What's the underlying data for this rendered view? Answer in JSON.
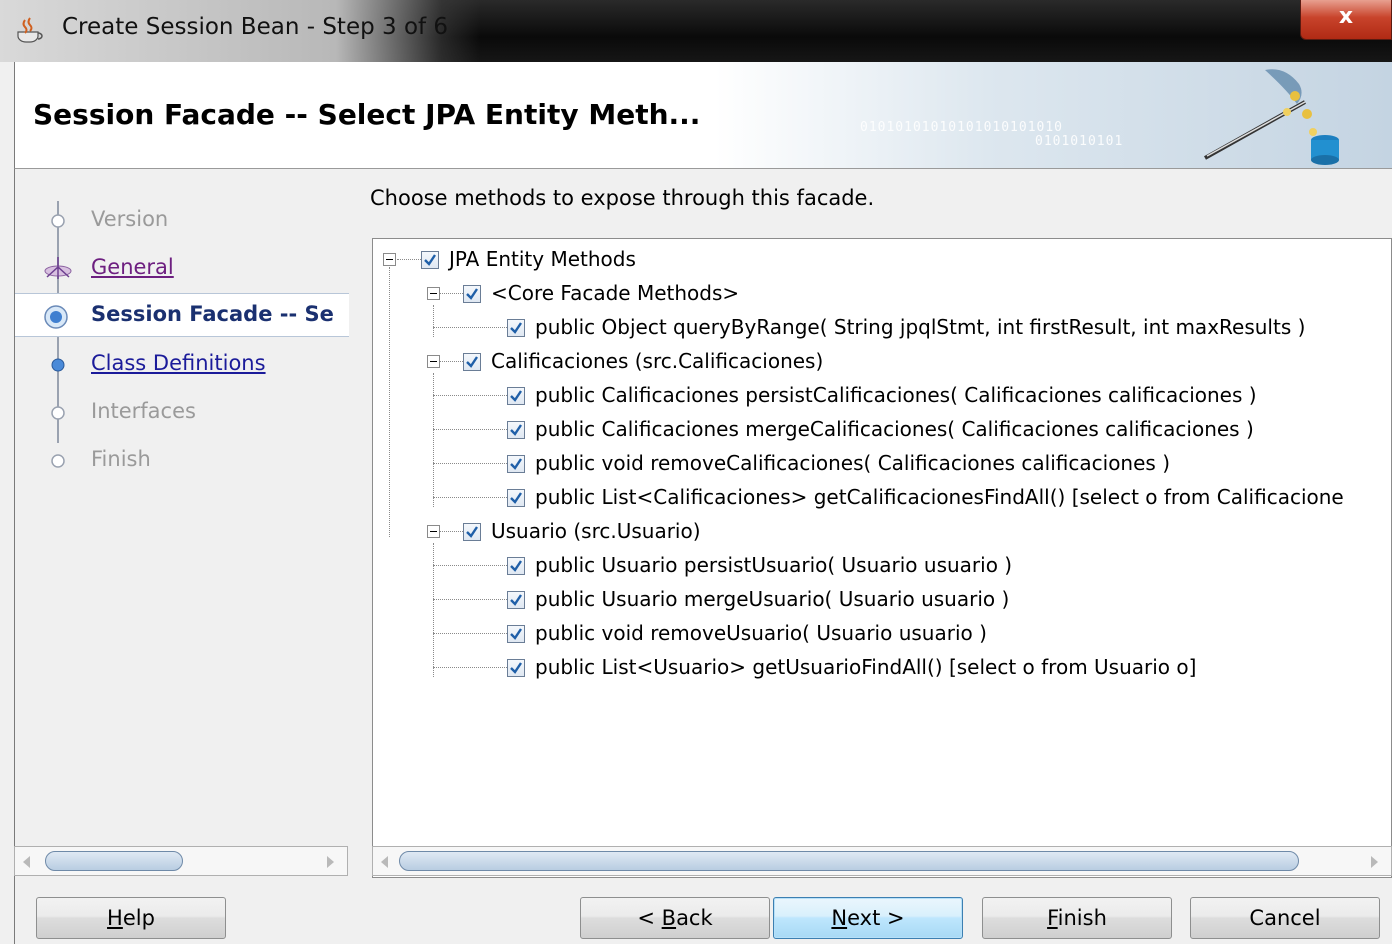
{
  "window": {
    "title": "Create Session Bean - Step 3 of 6",
    "close_label": "x"
  },
  "header": {
    "heading": "Session Facade -- Select JPA Entity Meth...",
    "binary_deco_1": "01010101010101010101010",
    "binary_deco_2": "0101010101"
  },
  "steps": [
    {
      "label": "Version",
      "state": "disabled"
    },
    {
      "label": "General",
      "state": "visited"
    },
    {
      "label": "Session Facade -- Se",
      "state": "current"
    },
    {
      "label": "Class Definitions",
      "state": "link"
    },
    {
      "label": "Interfaces",
      "state": "disabled"
    },
    {
      "label": "Finish",
      "state": "disabled"
    }
  ],
  "content": {
    "instruction": "Choose methods to expose through this facade."
  },
  "tree": {
    "root": "JPA Entity Methods",
    "groups": [
      {
        "label": "<Core Facade Methods>",
        "items": [
          "public Object queryByRange( String jpqlStmt, int firstResult, int maxResults )"
        ]
      },
      {
        "label": "Calificaciones (src.Calificaciones)",
        "items": [
          "public Calificaciones persistCalificaciones( Calificaciones calificaciones )",
          "public Calificaciones mergeCalificaciones( Calificaciones calificaciones )",
          "public void removeCalificaciones( Calificaciones calificaciones )",
          "public List<Calificaciones> getCalificacionesFindAll() [select o from Calificacione"
        ]
      },
      {
        "label": "Usuario (src.Usuario)",
        "items": [
          "public Usuario persistUsuario( Usuario usuario )",
          "public Usuario mergeUsuario( Usuario usuario )",
          "public void removeUsuario( Usuario usuario )",
          "public List<Usuario> getUsuarioFindAll() [select o from Usuario o]"
        ]
      }
    ]
  },
  "buttons": {
    "help_mn": "H",
    "help_rest": "elp",
    "back_pre": "< ",
    "back_mn": "B",
    "back_rest": "ack",
    "next_mn": "N",
    "next_rest": "ext >",
    "finish_mn": "F",
    "finish_rest": "inish",
    "cancel": "Cancel"
  },
  "colors": {
    "check": "#1f5fa8",
    "current_step": "#1a3070",
    "close": "#c8432b"
  }
}
